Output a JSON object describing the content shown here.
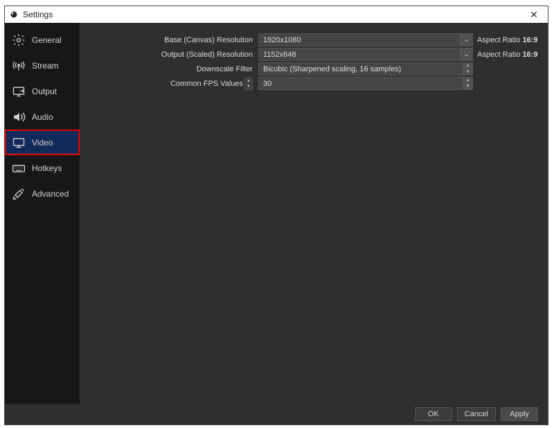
{
  "window": {
    "title": "Settings"
  },
  "sidebar": {
    "items": [
      {
        "label": "General"
      },
      {
        "label": "Stream"
      },
      {
        "label": "Output"
      },
      {
        "label": "Audio"
      },
      {
        "label": "Video"
      },
      {
        "label": "Hotkeys"
      },
      {
        "label": "Advanced"
      }
    ],
    "selected_index": 4
  },
  "video": {
    "base_resolution": {
      "label": "Base (Canvas) Resolution",
      "value": "1920x1080",
      "aspect_label": "Aspect Ratio",
      "aspect_value": "16:9"
    },
    "output_resolution": {
      "label": "Output (Scaled) Resolution",
      "value": "1152x648",
      "aspect_label": "Aspect Ratio",
      "aspect_value": "16:9"
    },
    "downscale": {
      "label": "Downscale Filter",
      "value": "Bicubic (Sharpened scaling, 16 samples)"
    },
    "fps": {
      "label": "Common FPS Values",
      "value": "30"
    }
  },
  "buttons": {
    "ok": "OK",
    "cancel": "Cancel",
    "apply": "Apply"
  }
}
